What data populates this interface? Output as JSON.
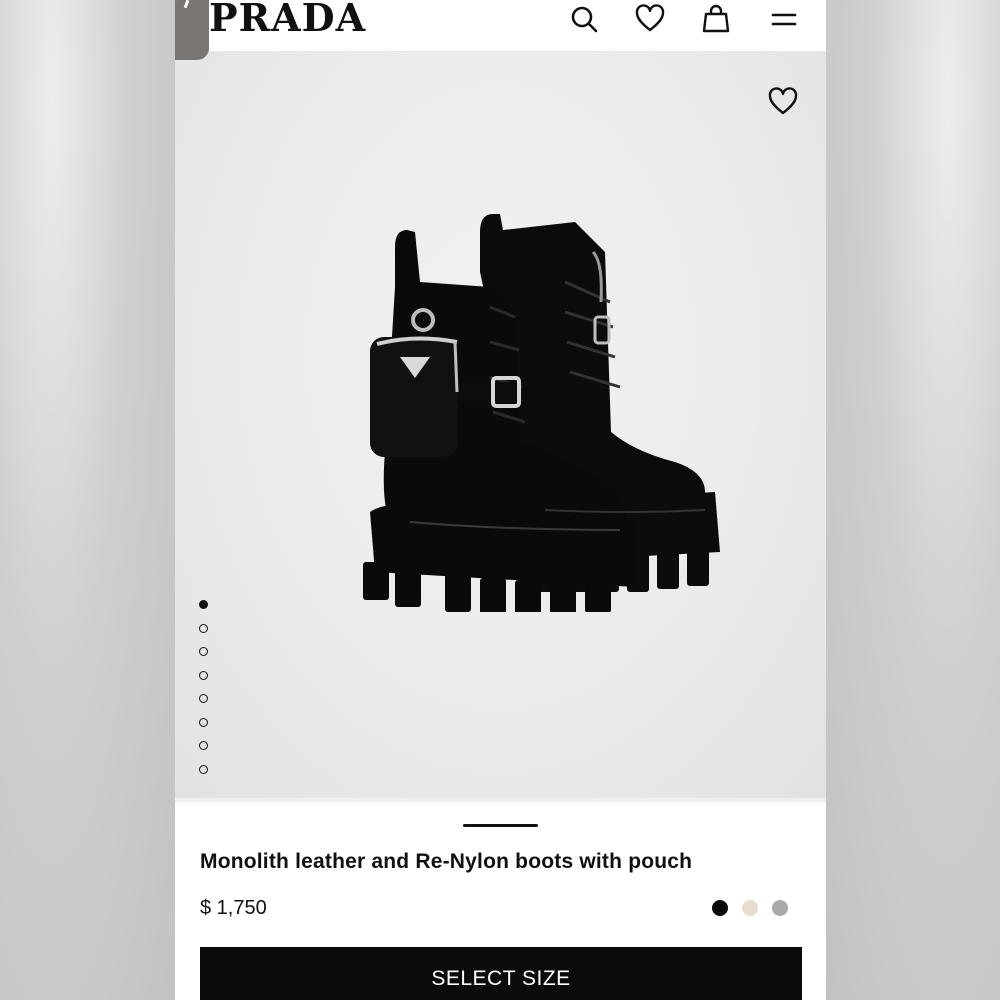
{
  "header": {
    "logo": "PRADA",
    "icons": [
      "search-icon",
      "heart-icon",
      "shopping-bag-icon",
      "menu-icon"
    ]
  },
  "product": {
    "gallery": {
      "current_index": 1,
      "total_images": 8
    },
    "title": "Monolith leather and Re-Nylon boots with pouch",
    "price": "$ 1,750",
    "color_options": [
      "#0a0a0a",
      "#e6ddce",
      "#a9a9a9"
    ],
    "cta_label": "SELECT SIZE"
  }
}
